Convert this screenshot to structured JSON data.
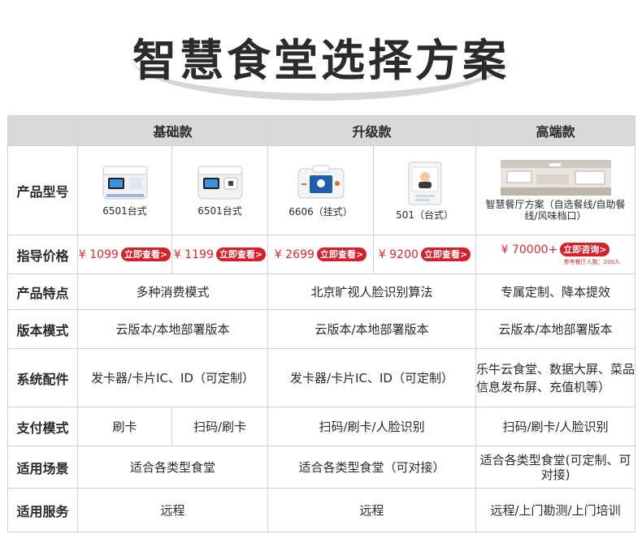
{
  "page": {
    "title": "智慧食堂选择方案"
  },
  "columns": {
    "basic": "基础款",
    "upgrade": "升级款",
    "premium": "高端款"
  },
  "rows": {
    "model": "产品型号",
    "price": "指导价格",
    "feature": "产品特点",
    "edition": "版本模式",
    "accessory": "系统配件",
    "payment": "支付模式",
    "scene": "适用场景",
    "service": "适用服务"
  },
  "products": [
    {
      "caption": "6501台式",
      "icon": "desktop-terminal-image"
    },
    {
      "caption": "6501台式",
      "icon": "desktop-terminal-image"
    },
    {
      "caption": "6606（挂式）",
      "icon": "wall-terminal-image"
    },
    {
      "caption": "501（台式）",
      "icon": "face-terminal-image"
    },
    {
      "caption": "智慧餐厅方案（自选餐线/自助餐线/风味档口）",
      "icon": "restaurant-photo"
    }
  ],
  "prices": [
    {
      "value": "¥ 1099",
      "button": "立即查看>"
    },
    {
      "value": "¥ 1199",
      "button": "立即查看>"
    },
    {
      "value": "¥  2699",
      "button": "立即查看>"
    },
    {
      "value": "¥  9200",
      "button": "立即查看>"
    },
    {
      "value": "¥  70000+",
      "button": "立即咨询>",
      "note": "参考餐厅人数：200人"
    }
  ],
  "features": {
    "basic": "多种消费模式",
    "upgrade": "北京旷视人脸识别算法",
    "premium": "专属定制、降本提效"
  },
  "editions": {
    "basic": "云版本/本地部署版本",
    "upgrade": "云版本/本地部署版本",
    "premium": "云版本/本地部署版本"
  },
  "accessories": {
    "basic": "发卡器/卡片IC、ID（可定制）",
    "upgrade": "发卡器/卡片IC、ID（可定制）",
    "premium": "乐牛云食堂、数据大屏、菜品信息发布屏、充值机等）"
  },
  "payments": {
    "basic_a": "刷卡",
    "basic_b": "扫码/刷卡",
    "upgrade": "扫码/刷卡/人脸识别",
    "premium": "扫码/刷卡/人脸识别"
  },
  "scenes": {
    "basic": "适合各类型食堂",
    "upgrade": "适合各类型食堂（可对接）",
    "premium": "适合各类型食堂(可定制、可对接)"
  },
  "services": {
    "basic": "远程",
    "upgrade": "远程",
    "premium": "远程/上门勘测/上门培训"
  },
  "colors": {
    "accent": "#d8202a",
    "header": "#d9d9d9",
    "border": "#d2d2d2"
  }
}
